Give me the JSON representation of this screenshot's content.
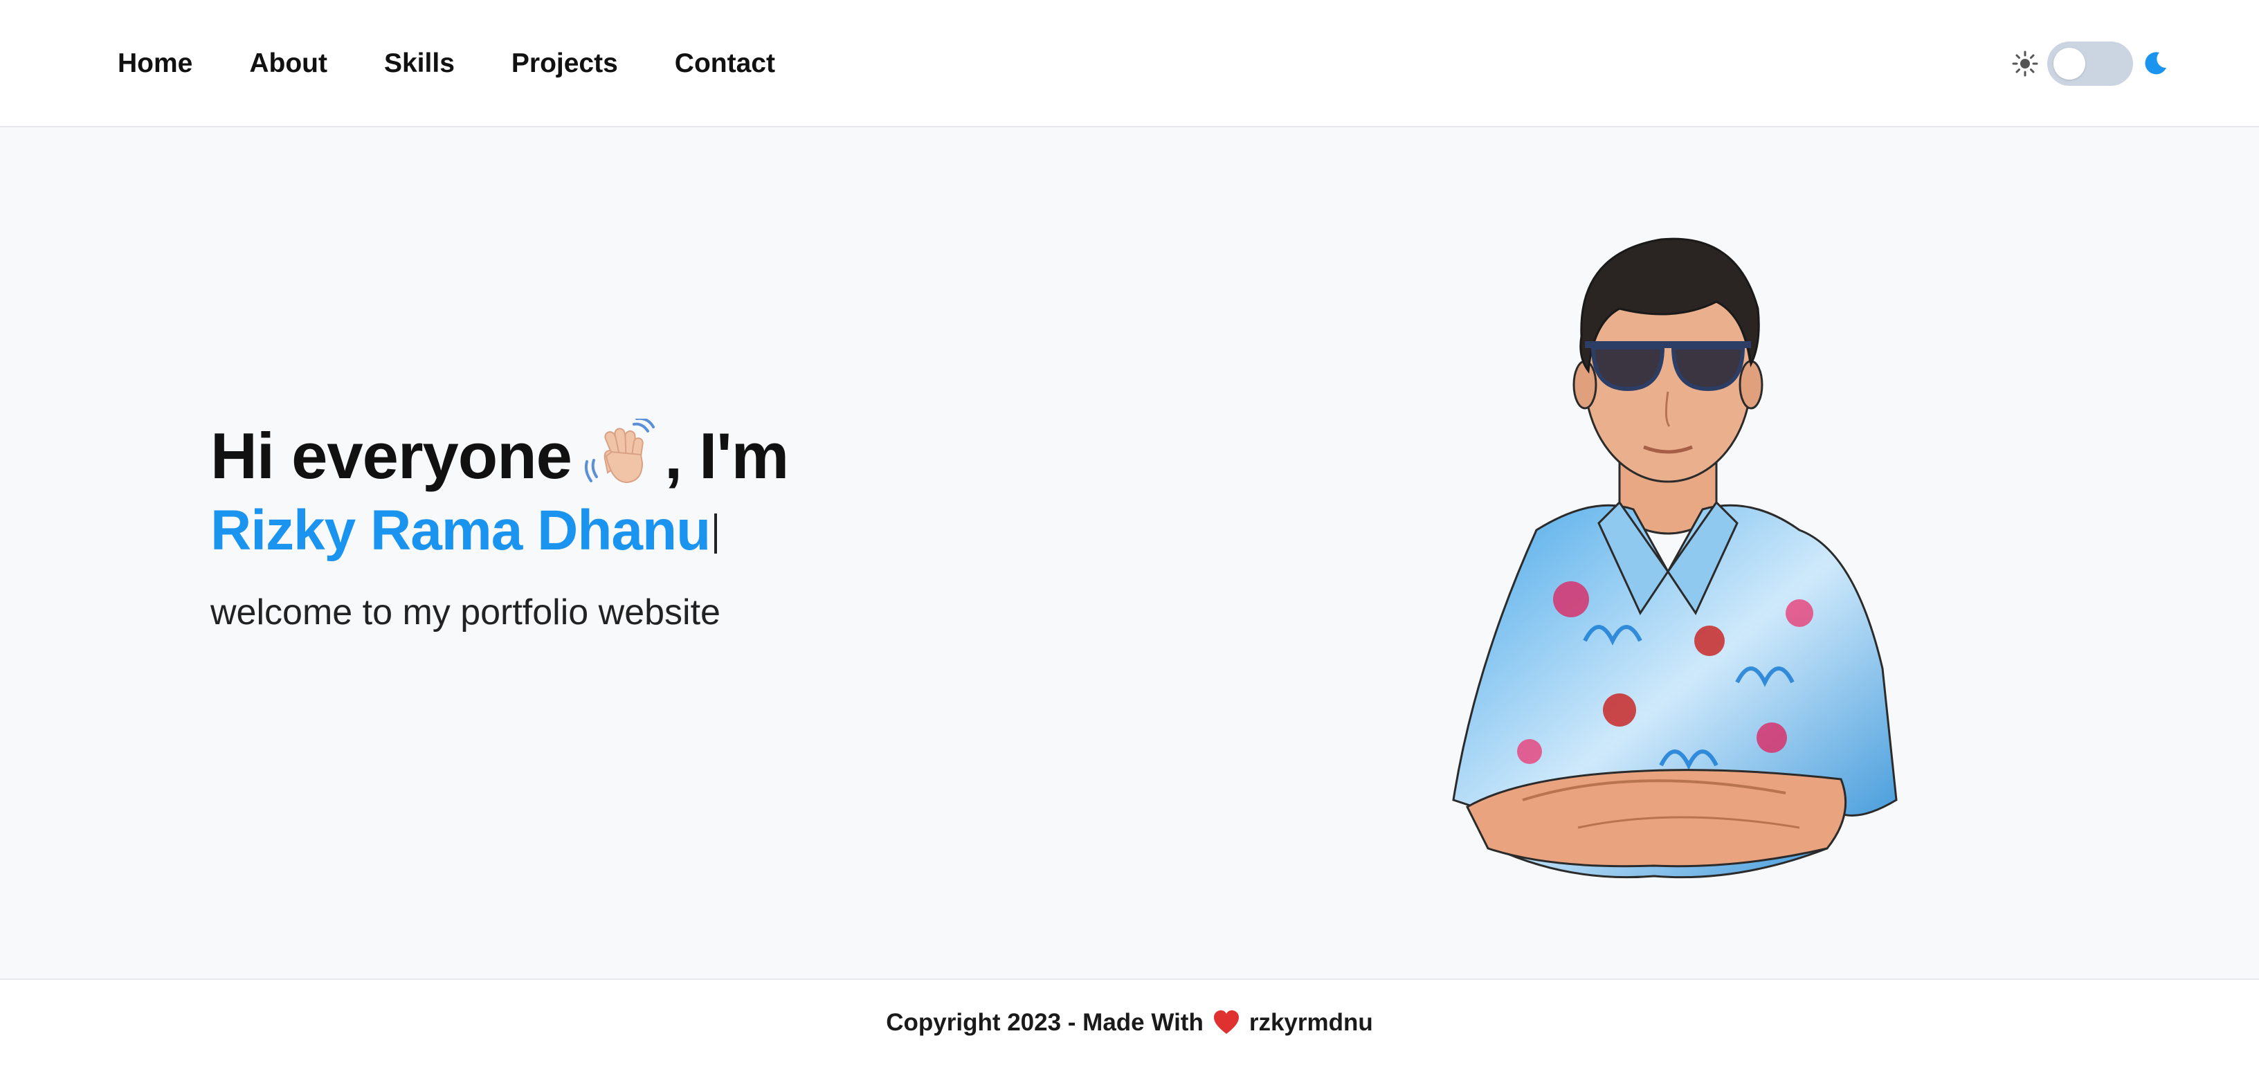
{
  "nav": {
    "items": [
      {
        "label": "Home"
      },
      {
        "label": "About"
      },
      {
        "label": "Skills"
      },
      {
        "label": "Projects"
      },
      {
        "label": "Contact"
      }
    ]
  },
  "theme_toggle": {
    "left_icon": "sun-icon",
    "right_icon": "moon-icon",
    "state": "light",
    "accent": "#1a94ee"
  },
  "hero": {
    "greeting_prefix": "Hi everyone",
    "greeting_suffix": ", I'm",
    "wave_icon": "waving-hand-icon",
    "name": "Rizky Rama Dhanu",
    "tagline": "welcome to my portfolio website",
    "name_color": "#1a94ee"
  },
  "footer": {
    "prefix": "Copyright 2023 - Made With",
    "heart_icon": "heart-icon",
    "author": "rzkyrmdnu"
  }
}
